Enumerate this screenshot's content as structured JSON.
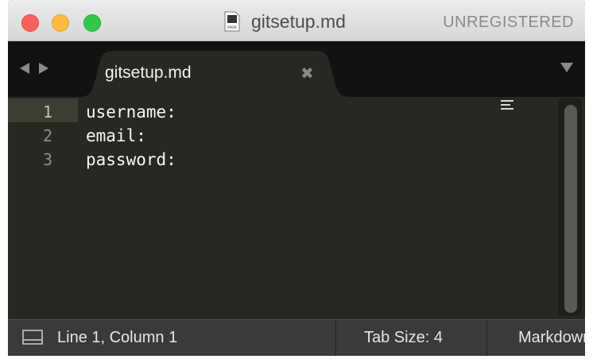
{
  "window": {
    "title": "gitsetup.md",
    "license_status": "UNREGISTERED",
    "doc_icon_label": "MARK"
  },
  "tabs": [
    {
      "label": "gitsetup.md",
      "active": true
    }
  ],
  "icons": {
    "nav_back": "triangle-left-icon",
    "nav_forward": "triangle-right-icon",
    "tab_close": "close-x-icon",
    "tab_dropdown": "triangle-down-icon",
    "panel_toggle": "panel-icon"
  },
  "editor": {
    "lines": [
      {
        "number": "1",
        "text": "username:"
      },
      {
        "number": "2",
        "text": "email:"
      },
      {
        "number": "3",
        "text": "password:"
      }
    ],
    "active_line": 1
  },
  "status": {
    "position": "Line 1, Column 1",
    "tab_size": "Tab Size: 4",
    "syntax": "Markdown"
  },
  "colors": {
    "editor_bg": "#272822",
    "tabbar_bg": "#121212",
    "statusbar_bg": "#3a3a3a",
    "text": "#f8f8f2",
    "line_number": "#8f908a",
    "close_light": "#fc605c",
    "min_light": "#fdbc40",
    "max_light": "#34c84a"
  }
}
